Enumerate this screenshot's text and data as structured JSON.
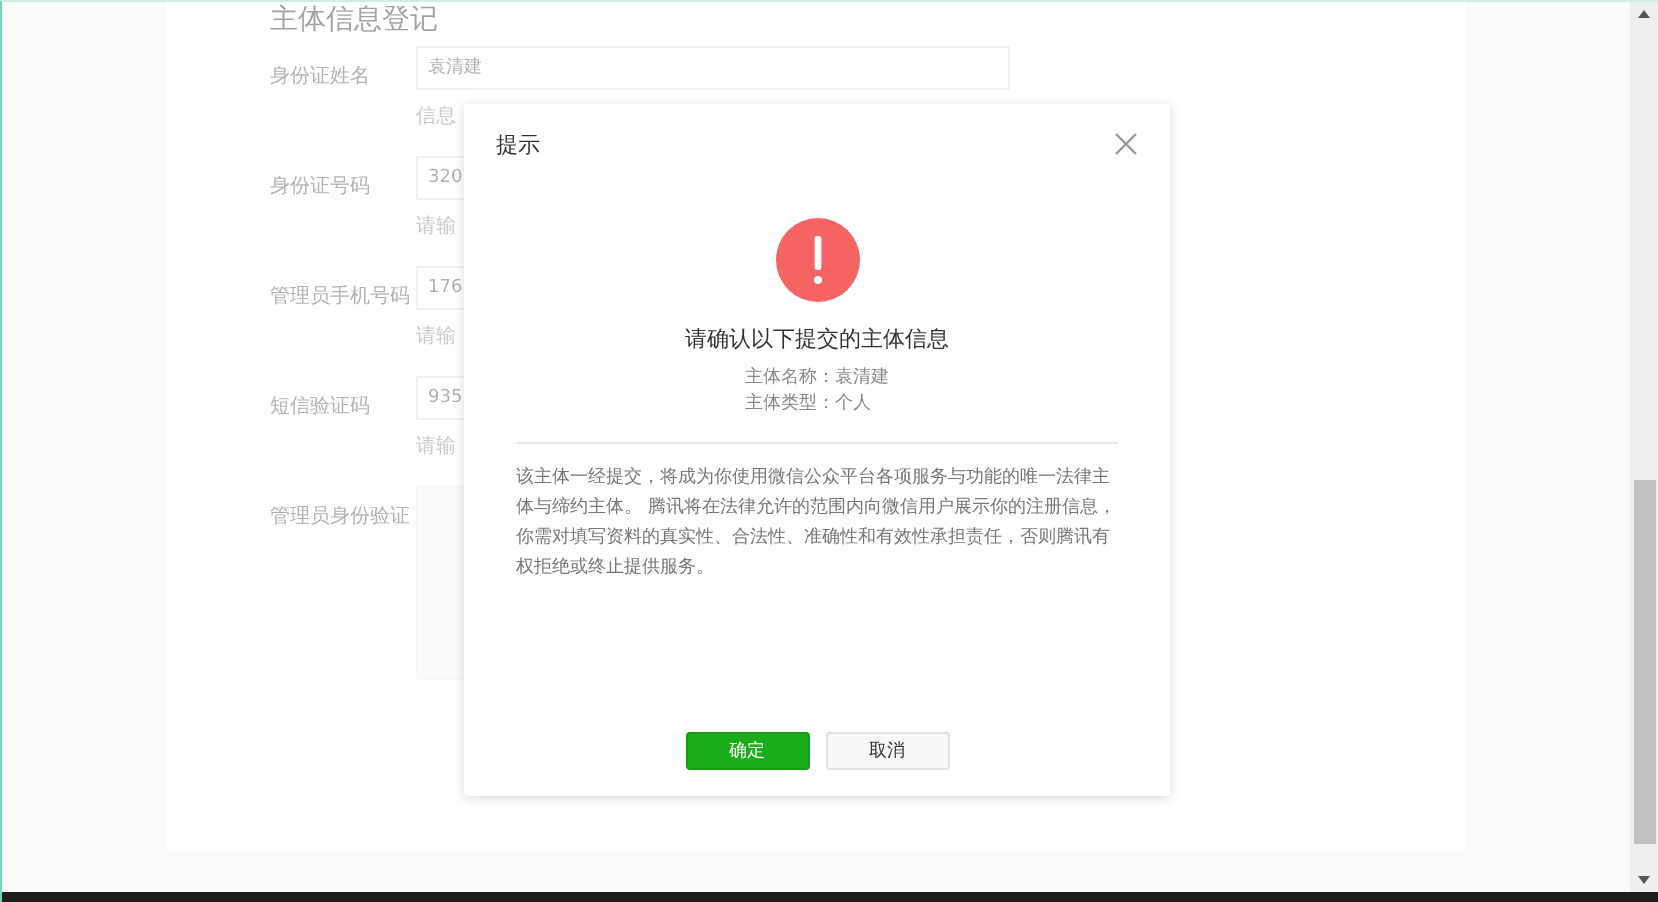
{
  "page": {
    "section_title": "主体信息登记",
    "fields": [
      {
        "kind": "input",
        "label": "身份证姓名",
        "value": "袁清建",
        "hint": "信息"
      },
      {
        "kind": "input",
        "label": "身份证号码",
        "value": "320",
        "hint": "请输"
      },
      {
        "kind": "input",
        "label": "管理员手机号码",
        "value": "176",
        "hint": "请输"
      },
      {
        "kind": "input",
        "label": "短信验证码",
        "value": "935",
        "hint": "请输"
      },
      {
        "kind": "upload",
        "label": "管理员身份验证"
      }
    ]
  },
  "dialog": {
    "title": "提示",
    "heading": "请确认以下提交的主体信息",
    "info": [
      "主体名称：袁清建",
      "主体类型：个人"
    ],
    "notice": "该主体一经提交，将成为你使用微信公众平台各项服务与功能的唯一法律主体与缔约主体。 腾讯将在法律允许的范围内向微信用户展示你的注册信息，你需对填写资料的真实性、合法性、准确性和有效性承担责任，否则腾讯有权拒绝或终止提供服务。",
    "buttons": [
      {
        "kind": "primary",
        "label": "确定"
      },
      {
        "kind": "default",
        "label": "取消"
      }
    ]
  }
}
